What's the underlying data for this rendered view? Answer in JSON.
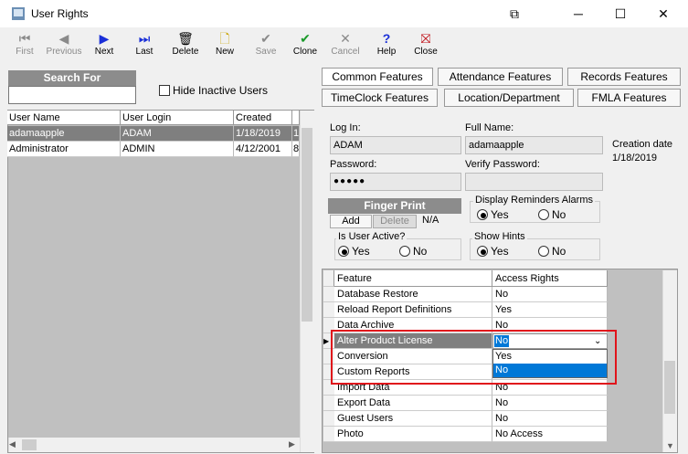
{
  "window": {
    "title": "User Rights"
  },
  "toolbar": {
    "first": "First",
    "previous": "Previous",
    "next": "Next",
    "last": "Last",
    "delete": "Delete",
    "new": "New",
    "save": "Save",
    "clone": "Clone",
    "cancel": "Cancel",
    "help": "Help",
    "close": "Close"
  },
  "search": {
    "label": "Search For",
    "value": "",
    "hide_inactive_label": "Hide Inactive Users"
  },
  "users_table": {
    "headers": [
      "User Name",
      "User Login",
      "Created"
    ],
    "rows": [
      {
        "name": "adamaapple",
        "login": "ADAM",
        "created": "1/18/2019",
        "extra": "1"
      },
      {
        "name": "Administrator",
        "login": "ADMIN",
        "created": "4/12/2001",
        "extra": "8"
      }
    ]
  },
  "tabs": {
    "common": "Common Features",
    "attendance": "Attendance Features",
    "records": "Records Features",
    "timeclock": "TimeClock Features",
    "location": "Location/Department",
    "fmla": "FMLA Features"
  },
  "form": {
    "login_label": "Log In:",
    "login_value": "ADAM",
    "fullname_label": "Full Name:",
    "fullname_value": "adamaapple",
    "password_label": "Password:",
    "password_value": "●●●●●",
    "verify_label": "Verify Password:",
    "verify_value": "",
    "creation_label": "Creation date",
    "creation_value": "1/18/2019",
    "fingerprint_label": "Finger Print",
    "add_label": "Add",
    "delete_label": "Delete",
    "fp_status": "N/A",
    "reminders_label": "Display Reminders Alarms",
    "reminders_yes": "Yes",
    "reminders_no": "No",
    "active_label": "Is User Active?",
    "active_yes": "Yes",
    "active_no": "No",
    "hints_label": "Show Hints",
    "hints_yes": "Yes",
    "hints_no": "No"
  },
  "features_table": {
    "headers": [
      "Feature",
      "Access Rights"
    ],
    "rows": [
      {
        "feature": "Database Restore",
        "access": "No"
      },
      {
        "feature": "Reload Report Definitions",
        "access": "Yes"
      },
      {
        "feature": "Data Archive",
        "access": "No"
      },
      {
        "feature": "Alter Product License",
        "access": "No"
      },
      {
        "feature": "Conversion",
        "access": ""
      },
      {
        "feature": "Custom Reports",
        "access": ""
      },
      {
        "feature": "Import Data",
        "access": "No"
      },
      {
        "feature": "Export Data",
        "access": "No"
      },
      {
        "feature": "Guest Users",
        "access": "No"
      },
      {
        "feature": "Photo",
        "access": "No Access"
      }
    ],
    "dropdown_options": [
      "Yes",
      "No"
    ]
  }
}
